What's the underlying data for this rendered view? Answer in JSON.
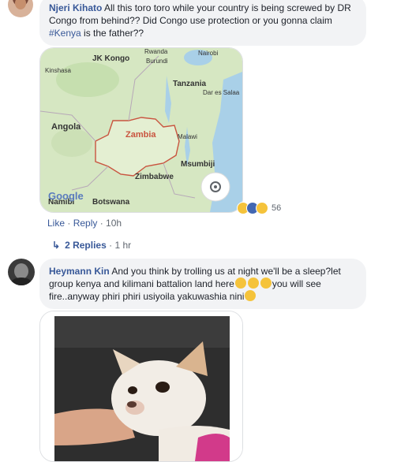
{
  "comment1": {
    "author": "Njeri Kihato",
    "text_before": " All this toro toro while your country is being screwed by DR Congo from behind?? Did Congo use protection or you gonna claim ",
    "hashtag": "#Kenya",
    "text_after": " is the father??",
    "actions": {
      "like": "Like",
      "sep": " · ",
      "reply": "Reply",
      "time": "10h"
    },
    "reaction_count": "56",
    "replies_label": "2 Replies",
    "replies_time": "1 hr",
    "map": {
      "labels": {
        "jk_kongo": "JK Kongo",
        "rwanda": "Rwanda",
        "burundi": "Burundi",
        "nairobi": "Nairobi",
        "kinshasa": "Kinshasa",
        "tanzania": "Tanzania",
        "dar": "Dar es Salaa",
        "angola": "Angola",
        "zambia": "Zambia",
        "malawi": "Malawi",
        "msumbiji": "Msumbiji",
        "zimbabwe": "Zimbabwe",
        "namibia": "Namibi",
        "botswana": "Botswana",
        "google": "Google"
      }
    }
  },
  "comment2": {
    "author": "Heymann Kin",
    "text_part1": " And you think by trolling us at night we'll be a sleep?let group kenya and kilimani battalion land here",
    "text_part2": "you will see fire..anyway phiri phiri usiyoila yakuwashia nini"
  },
  "colors": {
    "link": "#385898",
    "bubble": "#f2f3f5",
    "meta": "#606770"
  }
}
